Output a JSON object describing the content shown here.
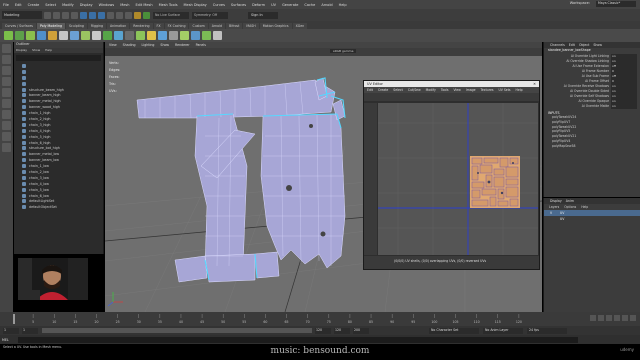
{
  "menubar": {
    "items": [
      "File",
      "Edit",
      "Create",
      "Select",
      "Modify",
      "Display",
      "Windows",
      "Mesh",
      "Edit Mesh",
      "Mesh Tools",
      "Mesh Display",
      "Curves",
      "Surfaces",
      "Deform",
      "UV",
      "Generate",
      "Cache",
      "Arnold",
      "Help"
    ],
    "workspace_label": "Workspace:",
    "workspace_value": "Maya Classic*"
  },
  "statusline": {
    "mode": "Modeling",
    "no_live": "No Live Surface",
    "symmetry": "Symmetry: Off",
    "signin": "Sign In"
  },
  "shelf": {
    "tabs": [
      "Curves / Surfaces",
      "Poly Modeling",
      "Sculpting",
      "Rigging",
      "Animation",
      "Rendering",
      "FX",
      "FX Caching",
      "Custom",
      "Arnold",
      "Bifrost",
      "MASH",
      "Motion Graphics",
      "XGen"
    ],
    "active_tab": 1,
    "icon_colors": [
      "#7bbf4a",
      "#5da04a",
      "#8ac04b",
      "#4f8fc9",
      "#d0a13a",
      "#c5c5c5",
      "#6b9fd4",
      "#9ac461",
      "#c9c9c9",
      "#56a548",
      "#5aa4d1",
      "#6b6b6b",
      "#8cc45a",
      "#e0c048",
      "#5ea0d8",
      "#9a9a9a",
      "#a3ce66",
      "#5b95c9",
      "#7cbb55",
      "#c0c0c0"
    ]
  },
  "outliner": {
    "title": "Outliner",
    "menu": [
      "Display",
      "Show",
      "Help"
    ],
    "items": [
      "",
      "",
      "",
      "",
      "structure_beam_high",
      "banner_beam_high",
      "banner_metal_high",
      "banner_wood_high",
      "chain_1_high",
      "chain_2_high",
      "chain_3_high",
      "chain_4_high",
      "chain_5_high",
      "chain_6_high",
      "structure_bot_high",
      "banner_metal_low",
      "banner_beam_low",
      "chain_1_low",
      "chain_2_low",
      "chain_3_low",
      "chain_4_low",
      "chain_5_low",
      "chain_6_low",
      "defaultLightSet",
      "defaultObjectSet"
    ]
  },
  "viewport": {
    "menu": [
      "View",
      "Shading",
      "Lighting",
      "Show",
      "Renderer",
      "Panels"
    ],
    "hud_labels": [
      "Verts:",
      "Edges:",
      "Faces:",
      "Tris:",
      "UVs:"
    ],
    "uv_set_label": "sRGB gamma"
  },
  "uv_editor": {
    "title": "UV Editor",
    "menu": [
      "Edit",
      "Create",
      "Select",
      "Cut/Sew",
      "Modify",
      "Tools",
      "View",
      "Image",
      "Textures",
      "UV Sets",
      "Help"
    ],
    "status": "(0/0/0) UV shells, (0/0) overlapping UVs, (0/0) reversed UVs"
  },
  "channel_box": {
    "tabs": [
      "Channels",
      "Edit",
      "Object",
      "Show"
    ],
    "menu": [
      "Channels",
      "Edit",
      "Object",
      "Show"
    ],
    "object": "standee_banner_lowShape",
    "attributes": [
      {
        "label": "Ai Override Light Linking",
        "value": "on"
      },
      {
        "label": "Ai Override Shadow Linking",
        "value": "on"
      },
      {
        "label": "Ai Use Frame Extension",
        "value": "off"
      },
      {
        "label": "Ai Frame Number",
        "value": "0"
      },
      {
        "label": "Ai Use Sub Frame",
        "value": "off"
      },
      {
        "label": "Ai Frame Offset",
        "value": "0"
      },
      {
        "label": "Ai Override Receive Shadows",
        "value": "on"
      },
      {
        "label": "Ai Override Double Sided",
        "value": "on"
      },
      {
        "label": "Ai Override Self Shadows",
        "value": "on"
      },
      {
        "label": "Ai Override Opaque",
        "value": "on"
      },
      {
        "label": "Ai Override Matte",
        "value": "on"
      }
    ],
    "inputs_header": "INPUTS",
    "inputs": [
      "polyTweakUV24",
      "polyFlipUV7",
      "polyTweakUV22",
      "polyFlipUV5",
      "polyTweakUV21",
      "polyFlipUV4",
      "polyMapSew38"
    ]
  },
  "layers": {
    "tabs": [
      "Display",
      "Anim"
    ],
    "menu": [
      "Layers",
      "Options",
      "Help"
    ],
    "rows": [
      {
        "vis": "V",
        "name": "UV",
        "sel": true
      },
      {
        "vis": "",
        "name": "UV",
        "sel": false
      }
    ]
  },
  "timeline": {
    "ticks": [
      "5",
      "10",
      "15",
      "20",
      "25",
      "30",
      "35",
      "40",
      "45",
      "50",
      "55",
      "60",
      "65",
      "70",
      "75",
      "80",
      "85",
      "90",
      "95",
      "100",
      "105",
      "110",
      "115",
      "120"
    ],
    "current": "1"
  },
  "range": {
    "start": "1",
    "start2": "1",
    "end": "120",
    "end2": "120",
    "end3": "200",
    "char_set": "No Character Set",
    "anim_layer": "No Anim Layer",
    "fps": "24 fps"
  },
  "cmdline": {
    "label": "MEL"
  },
  "help": {
    "text": "Select a UV. Use tools in Mesh menu."
  },
  "watermark": {
    "text": "music: bensound.com",
    "logo": "udemy"
  },
  "colors": {
    "mesh_fill": "#a7a6d6",
    "mesh_line": "#dcdcff",
    "mesh_seam": "#55d7ff",
    "uv_fill": "#e0a870",
    "uv_edge": "#7a5aa5",
    "uv_axis": "#2b3fd0"
  }
}
